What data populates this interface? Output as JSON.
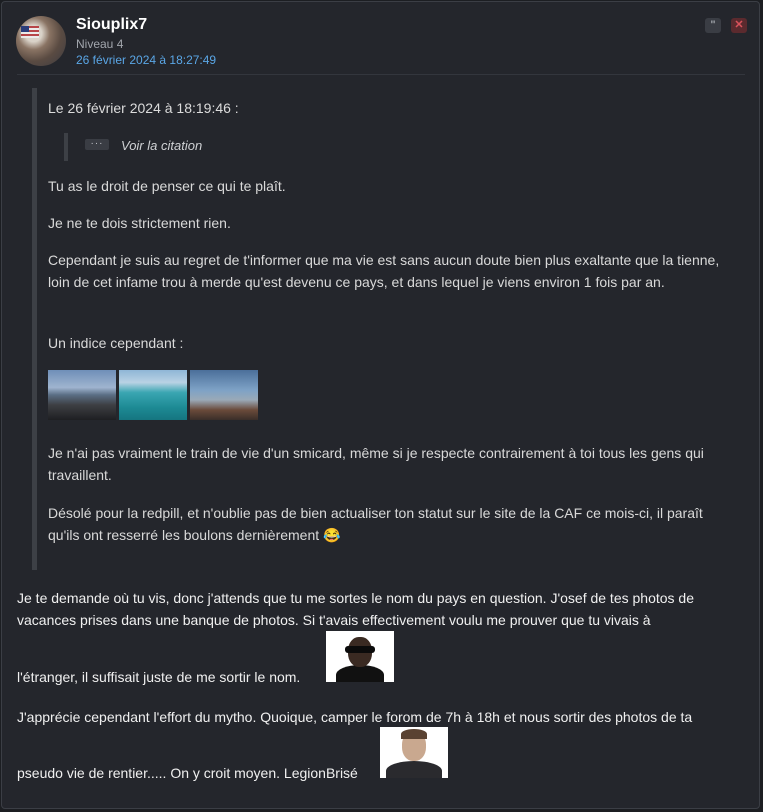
{
  "post": {
    "author": "Siouplix7",
    "level": "Niveau 4",
    "date": "26 février 2024 à 18:27:49",
    "quote_button_icon": "quote-icon",
    "close_button_icon": "close-icon",
    "quote_button_glyph": "\"",
    "close_button_glyph": "✕"
  },
  "quote": {
    "header": "Le 26 février 2024 à 18:19:46 :",
    "nested_dots": "···",
    "nested_label": "Voir la citation",
    "paragraphs": [
      "Tu as le droit de penser ce qui te plaît.",
      "Je ne te dois strictement rien.",
      "Cependant je suis au regret de t'informer que ma vie est sans aucun doute bien plus exaltante que la tienne, loin de cet infame trou à merde qu'est devenu ce pays, et dans lequel je viens environ 1 fois par an.",
      "Un indice cependant :",
      "Je n'ai pas vraiment le train de vie d'un smicard, même si je respecte contrairement à toi tous les gens qui travaillent.",
      "Désolé pour la redpill, et n'oublie pas de bien actualiser ton statut sur le site de la CAF ce mois-ci, il paraît qu'ils ont resserré les boulons dernièrement 😂"
    ]
  },
  "message": {
    "p1_lines": [
      "Je te demande où tu vis, donc j'attends que tu me sortes le nom du pays en question. J'osef de tes photos de",
      "vacances prises dans une banque de photos. Si t'avais effectivement voulu me prouver que tu vivais à",
      "l'étranger, il suffisait juste de me sortir le nom."
    ],
    "p2_lines": [
      "J'apprécie cependant l'effort du mytho. Quoique, camper le forom de 7h à 18h et nous sortir des photos de ta",
      "pseudo vie de rentier..... On y croit moyen. LegionBrisé"
    ]
  }
}
